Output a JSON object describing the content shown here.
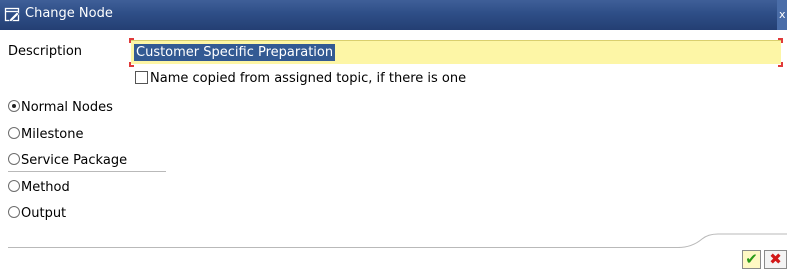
{
  "window": {
    "title": "Change Node",
    "title_icon": "edit-window-icon",
    "close_glyph": "x"
  },
  "description": {
    "label": "Description",
    "value": "Customer Specific Preparation"
  },
  "name_copied_checkbox": {
    "label": "Name copied from assigned topic, if there is one",
    "checked": false
  },
  "node_types": {
    "selected": "Normal Nodes",
    "options": [
      "Normal Nodes",
      "Milestone",
      "Service Package",
      "Method",
      "Output"
    ]
  },
  "footer": {
    "confirm_icon": "checkmark-icon",
    "cancel_icon": "cancel-x-icon",
    "confirm_glyph": "✔",
    "cancel_glyph": "✖"
  },
  "colors": {
    "titlebar": "#2e4e87",
    "input_background": "#fdf6a6",
    "selection": "#335a93",
    "required_marker": "#e03a3a",
    "confirm": "#2a9a18",
    "cancel": "#d21818"
  }
}
